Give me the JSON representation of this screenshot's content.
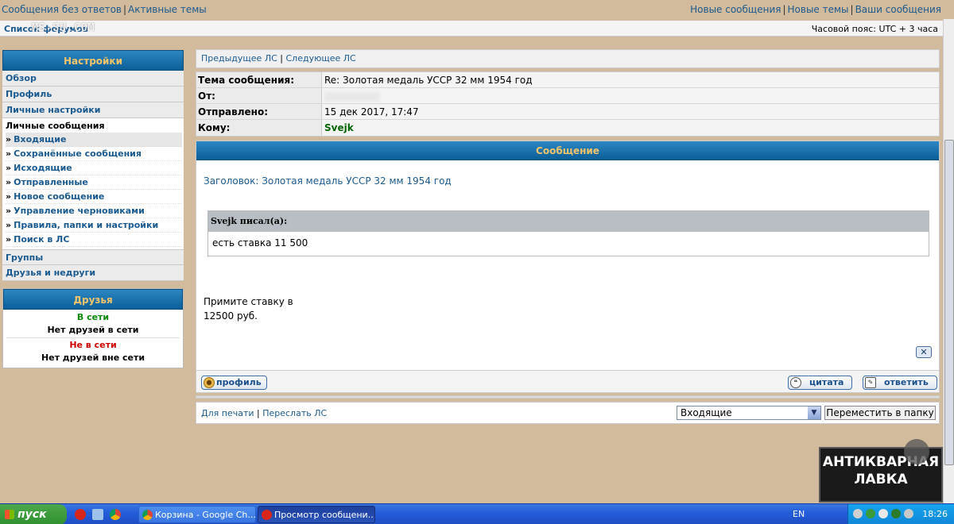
{
  "top_links": {
    "left": [
      "Сообщения без ответов",
      "Активные темы"
    ],
    "right": [
      "Новые сообщения",
      "Новые темы",
      "Ваши сообщения"
    ]
  },
  "navbar": {
    "forums_list": "Список форумов",
    "watermark": "MS-SU.COM",
    "timezone": "Часовой пояс: UTC + 3 часа"
  },
  "settings": {
    "title": "Настройки",
    "items": [
      "Обзор",
      "Профиль",
      "Личные настройки"
    ],
    "pm_title": "Личные сообщения",
    "pm_links": [
      "Входящие",
      "Сохранённые сообщения",
      "Исходящие",
      "Отправленные",
      "Новое сообщение",
      "Управление черновиками",
      "Правила, папки и настройки",
      "Поиск в ЛС"
    ],
    "pm_active_index": 0,
    "bottom_items": [
      "Группы",
      "Друзья и недруги"
    ]
  },
  "friends": {
    "title": "Друзья",
    "online_label": "В сети",
    "online_empty": "Нет друзей в сети",
    "offline_label": "Не в сети",
    "offline_empty": "Нет друзей вне сети"
  },
  "pager": {
    "prev": "Предыдущее ЛС",
    "next": "Следующее ЛС"
  },
  "info": {
    "subject_label": "Тема сообщения:",
    "subject_value": "Re: Золотая медаль УССР 32 мм 1954 год",
    "from_label": "От:",
    "sent_label": "Отправлено:",
    "sent_value": "15 дек 2017, 17:47",
    "to_label": "Кому:",
    "to_value": "Svejk"
  },
  "message": {
    "header": "Сообщение",
    "subject_line": "Заголовок: Золотая медаль УССР 32 мм 1954 год",
    "quote_author": "Svejk писал(а):",
    "quote_text": "есть ставка 11 500",
    "reply_line1": "Примите ставку в",
    "reply_line2": "12500 руб.",
    "close_glyph": "✕",
    "btn_profile": "профиль",
    "btn_quote": "цитата",
    "btn_reply": "ответить"
  },
  "bottom": {
    "print": "Для печати",
    "forward": "Переслать ЛС",
    "folder_selected": "Входящие",
    "move_button": "Переместить в папку"
  },
  "logo": {
    "line1": "АНТИКВАРНАЯ",
    "line2": "ЛАВКА"
  },
  "taskbar": {
    "start": "пуск",
    "tasks": [
      "Корзина - Google Ch...",
      "Просмотр сообщени..."
    ],
    "lang": "EN",
    "clock": "18:26"
  },
  "colors": {
    "accent_header": "#0b5f98",
    "header_text": "#f4c46a",
    "link": "#1b5a8f",
    "page_bg": "#d2bb9c"
  }
}
